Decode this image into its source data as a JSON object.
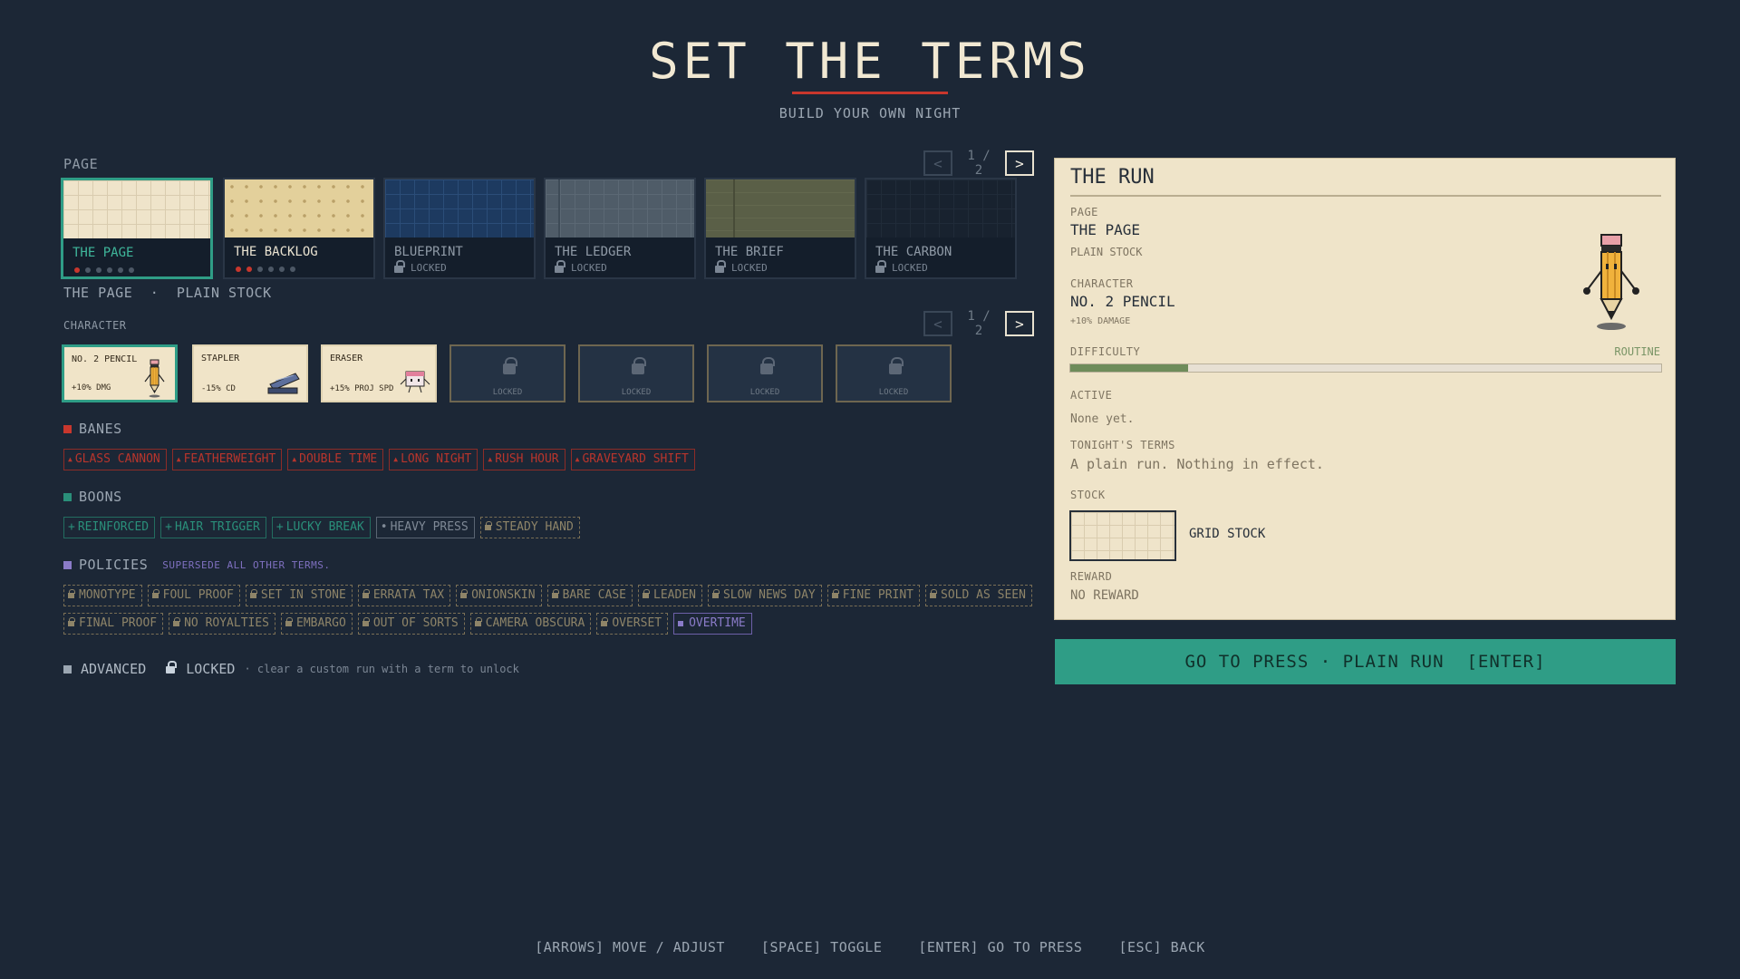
{
  "header": {
    "title": "SET THE TERMS",
    "subtitle": "BUILD YOUR OWN NIGHT"
  },
  "page_section": {
    "label": "PAGE",
    "pager": {
      "prev": "<",
      "next": ">",
      "count": "1 / 2"
    },
    "cards": [
      {
        "name": "THE PAGE",
        "status": "selected",
        "dots_filled": 1,
        "dots_total": 6
      },
      {
        "name": "THE BACKLOG",
        "status": "unlocked",
        "dots_filled": 2,
        "dots_total": 6
      },
      {
        "name": "BLUEPRINT",
        "status": "LOCKED"
      },
      {
        "name": "THE LEDGER",
        "status": "LOCKED"
      },
      {
        "name": "THE BRIEF",
        "status": "LOCKED"
      },
      {
        "name": "THE CARBON",
        "status": "LOCKED"
      }
    ],
    "summary_name": "THE PAGE",
    "summary_sep": "·",
    "summary_stock": "PLAIN STOCK"
  },
  "character_section": {
    "label": "CHARACTER",
    "pager": {
      "prev": "<",
      "next": ">",
      "count": "1 / 2"
    },
    "cards": [
      {
        "name": "NO. 2 PENCIL",
        "stat": "+10% DMG"
      },
      {
        "name": "STAPLER",
        "stat": "-15% CD"
      },
      {
        "name": "ERASER",
        "stat": "+15% PROJ SPD"
      },
      {
        "name": "LOCKED"
      },
      {
        "name": "LOCKED"
      },
      {
        "name": "LOCKED"
      },
      {
        "name": "LOCKED"
      }
    ]
  },
  "banes": {
    "label": "BANES",
    "color": "#c8372d",
    "items": [
      "GLASS CANNON",
      "FEATHERWEIGHT",
      "DOUBLE TIME",
      "LONG NIGHT",
      "RUSH HOUR",
      "GRAVEYARD SHIFT"
    ]
  },
  "boons": {
    "label": "BOONS",
    "color": "#2a8f7a",
    "items": [
      "REINFORCED",
      "HAIR TRIGGER",
      "LUCKY BREAK",
      "HEAVY PRESS",
      "STEADY HAND"
    ]
  },
  "policies": {
    "label": "POLICIES",
    "note": "SUPERSEDE ALL OTHER TERMS.",
    "color": "#8a7bc8",
    "row1": [
      "MONOTYPE",
      "FOUL PROOF",
      "SET IN STONE",
      "ERRATA TAX",
      "ONIONSKIN",
      "BARE CASE",
      "LEADEN",
      "SLOW NEWS DAY",
      "FINE PRINT",
      "SOLD AS SEEN"
    ],
    "row2": [
      "FINAL PROOF",
      "NO ROYALTIES",
      "EMBARGO",
      "OUT OF SORTS",
      "CAMERA OBSCURA",
      "OVERSET",
      "OVERTIME"
    ]
  },
  "advanced": {
    "label": "ADVANCED",
    "status": "LOCKED",
    "hint": "· clear a custom run with a term to unlock"
  },
  "run_panel": {
    "title": "THE RUN",
    "page_label": "PAGE",
    "page_value": "THE PAGE",
    "page_sub": "PLAIN STOCK",
    "character_label": "CHARACTER",
    "character_value": "NO. 2 PENCIL",
    "character_sub": "+10% DAMAGE",
    "difficulty_label": "DIFFICULTY",
    "difficulty_level": "ROUTINE",
    "difficulty_fraction": 0.2,
    "active_label": "ACTIVE",
    "active_value": "None yet.",
    "terms_label": "TONIGHT'S TERMS",
    "terms_value": "A plain run. Nothing in effect.",
    "stock_label": "STOCK",
    "stock_value": "GRID STOCK",
    "reward_label": "REWARD",
    "reward_value": "NO REWARD"
  },
  "press_button": "GO TO PRESS · PLAIN RUN  [ENTER]",
  "footer": [
    "[ARROWS] MOVE / ADJUST",
    "[SPACE] TOGGLE",
    "[ENTER] GO TO PRESS",
    "[ESC] BACK"
  ]
}
